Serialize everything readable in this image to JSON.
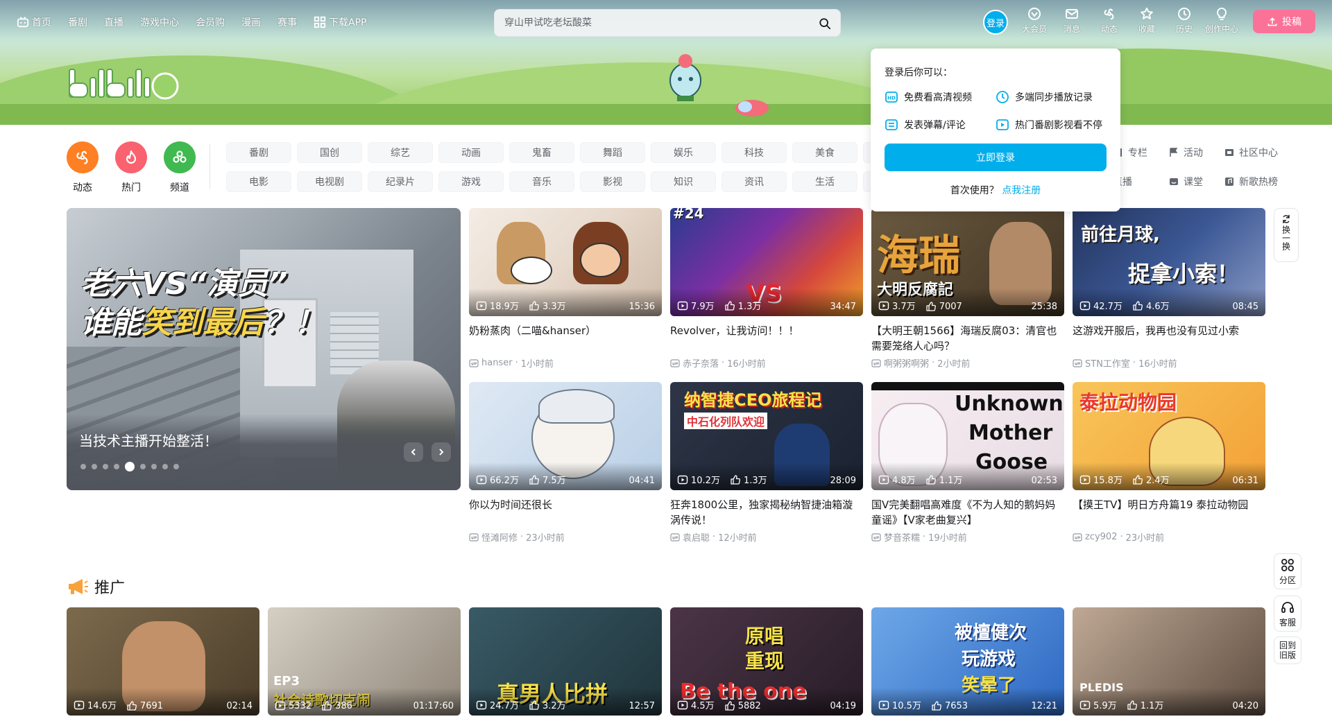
{
  "nav": {
    "items": [
      {
        "label": "首页",
        "icon": "tv-icon"
      },
      {
        "label": "番剧"
      },
      {
        "label": "直播"
      },
      {
        "label": "游戏中心"
      },
      {
        "label": "会员购"
      },
      {
        "label": "漫画"
      },
      {
        "label": "赛事"
      },
      {
        "label": "下载APP",
        "icon": "grid-icon"
      }
    ],
    "search_placeholder": "穿山甲试吃老坛酸菜",
    "login": "登录",
    "right": [
      {
        "label": "大会员",
        "icon": "vip-icon"
      },
      {
        "label": "消息",
        "icon": "mail-icon"
      },
      {
        "label": "动态",
        "icon": "wind-icon"
      },
      {
        "label": "收藏",
        "icon": "star-icon"
      },
      {
        "label": "历史",
        "icon": "clock-icon"
      },
      {
        "label": "创作中心",
        "icon": "bulb-icon"
      }
    ],
    "upload": "投稿"
  },
  "channels": {
    "circles": [
      {
        "label": "动态",
        "color": "#ff7f24"
      },
      {
        "label": "热门",
        "color": "#f9626e"
      },
      {
        "label": "频道",
        "color": "#3fb950"
      }
    ],
    "row1": [
      "番剧",
      "国创",
      "综艺",
      "动画",
      "鬼畜",
      "舞蹈",
      "娱乐",
      "科技",
      "美食",
      ""
    ],
    "row2": [
      "电影",
      "电视剧",
      "纪录片",
      "游戏",
      "音乐",
      "影视",
      "知识",
      "资讯",
      "生活",
      ""
    ],
    "right": [
      {
        "label": "专栏"
      },
      {
        "label": "活动"
      },
      {
        "label": "社区中心"
      },
      {
        "label": "直播"
      },
      {
        "label": "课堂"
      },
      {
        "label": "新歌热榜"
      }
    ]
  },
  "login_popup": {
    "title": "登录后你可以：",
    "features": [
      "免费看高清视频",
      "多端同步播放记录",
      "发表弹幕/评论",
      "热门番剧影视看不停"
    ],
    "button": "立即登录",
    "first_use": "首次使用？",
    "register": "点我注册"
  },
  "carousel": {
    "headline_a": "老六VS“演员”",
    "headline_b1": "谁能",
    "headline_b2": "笑到最后",
    "headline_b3": "？！",
    "caption": "当技术主播开始整活！",
    "dots": 9,
    "active": 4
  },
  "videos": [
    {
      "views": "18.9万",
      "likes": "3.3万",
      "duration": "15:36",
      "title": "奶粉蒸肉（二喵&hanser）",
      "up": "hanser",
      "time": "1小时前"
    },
    {
      "views": "7.9万",
      "likes": "1.3万",
      "duration": "34:47",
      "title": "Revolver，让我访问！！！",
      "up": "赤子奈落",
      "time": "16小时前"
    },
    {
      "views": "3.7万",
      "likes": "7007",
      "duration": "25:38",
      "title": "【大明王朝1566】海瑞反腐03：清官也需要笼络人心吗？",
      "up": "啊粥粥啊粥",
      "time": "2小时前"
    },
    {
      "views": "42.7万",
      "likes": "4.6万",
      "duration": "08:45",
      "title": "这游戏开服后，我再也没有见过小索",
      "up": "STN工作室",
      "time": "16小时前"
    },
    {
      "views": "66.2万",
      "likes": "7.5万",
      "duration": "04:41",
      "title": "你以为时间还很长",
      "up": "怪滩阿修",
      "time": "23小时前"
    },
    {
      "views": "10.2万",
      "likes": "1.3万",
      "duration": "28:09",
      "title": "狂奔1800公里，独家揭秘纳智捷油箱漩涡传说！",
      "up": "袁启聪",
      "time": "12小时前"
    },
    {
      "views": "4.8万",
      "likes": "1.1万",
      "duration": "02:53",
      "title": "国V完美翻唱高难度《不为人知的鹅妈妈童谣》【V家老曲复兴】",
      "up": "梦音茶糯",
      "time": "19小时前"
    },
    {
      "views": "15.8万",
      "likes": "2.4万",
      "duration": "06:31",
      "title": "【摸王TV】明日方舟篇19 泰拉动物园",
      "up": "zcy902",
      "time": "23小时前"
    }
  ],
  "thumb_text": {
    "v2_badge": "#24",
    "v2_a": "VS",
    "v3_a": "海瑞",
    "v3_b": "大明反腐記",
    "v4_a": "前往月球,",
    "v4_b": "捉拿小索！",
    "v6_a": "纳智捷CEO旅程记",
    "v6_b": "中石化列队欢迎",
    "v7_a": "Unknown",
    "v7_b": "Mother",
    "v7_c": "Goose",
    "v8_a": "泰拉动物园",
    "p2_a": "EP3",
    "p2_b": "社会诗歌切克闹",
    "p3_a": "真男人比拼",
    "p4_a": "原唱",
    "p4_b": "重现",
    "p4_c": "Be the one",
    "p5_a": "被檀健次",
    "p5_b": "玩游戏",
    "p5_c": "笑晕了",
    "p6_a": "PLEDIS"
  },
  "side": {
    "refresh": "换一换",
    "partition": "分区",
    "service": "客服",
    "old_version_1": "回到",
    "old_version_2": "旧版"
  },
  "promo": {
    "title": "推广",
    "videos": [
      {
        "views": "14.6万",
        "likes": "7691",
        "duration": "02:14"
      },
      {
        "views": "5332",
        "likes": "386",
        "duration": "01:17:60"
      },
      {
        "views": "24.7万",
        "likes": "3.2万",
        "duration": "12:57"
      },
      {
        "views": "4.5万",
        "likes": "5882",
        "duration": "04:19"
      },
      {
        "views": "10.5万",
        "likes": "7653",
        "duration": "12:21"
      },
      {
        "views": "5.9万",
        "likes": "1.1万",
        "duration": "04:20"
      }
    ]
  },
  "colors": {
    "brand_pink": "#fb7299",
    "brand_blue": "#00aeec"
  }
}
